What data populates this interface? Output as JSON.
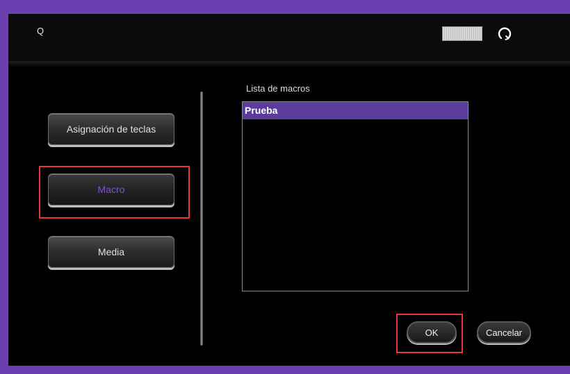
{
  "window": {
    "title": "Q"
  },
  "sidebar": {
    "items": [
      {
        "label": "Asignación de teclas",
        "selected": false
      },
      {
        "label": "Macro",
        "selected": true
      },
      {
        "label": "Media",
        "selected": false
      }
    ]
  },
  "macros": {
    "label": "Lista de macros",
    "items": [
      {
        "name": "Prueba",
        "selected": true
      }
    ]
  },
  "footer": {
    "ok_label": "OK",
    "cancel_label": "Cancelar"
  },
  "colors": {
    "frame": "#6b3fb0",
    "accent": "#7b55d6",
    "selection": "#5a3d9a",
    "highlight": "#e53935"
  },
  "icons": {
    "keyboard": "keyboard-thumbnail-icon",
    "refresh": "refresh-icon"
  }
}
